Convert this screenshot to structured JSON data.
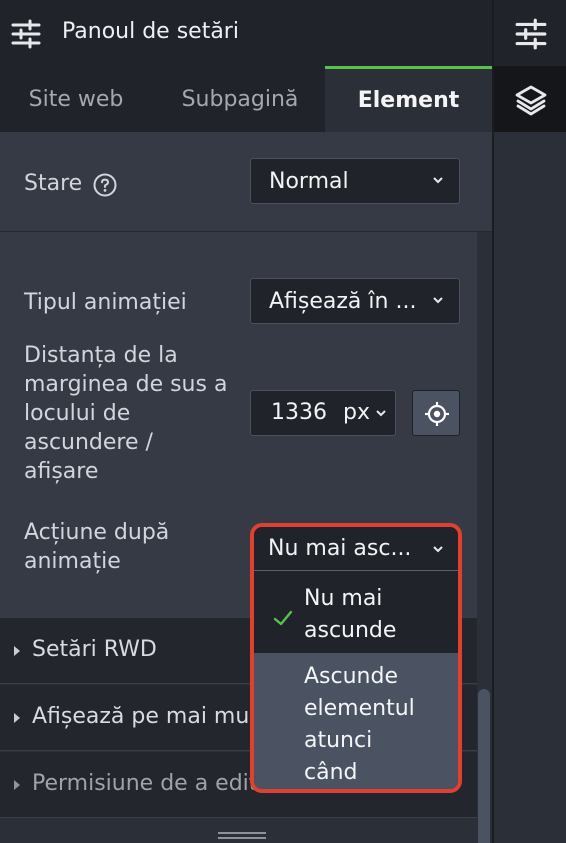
{
  "header": {
    "title": "Panoul de setări",
    "settings_icon": "sliders-icon"
  },
  "rail": {
    "top_icon": "sliders-icon",
    "layers_icon": "layers-icon"
  },
  "tabs": [
    {
      "label": "Site web"
    },
    {
      "label": "Subpagină"
    },
    {
      "label": "Element",
      "active": true
    }
  ],
  "state": {
    "label": "Stare",
    "value": "Normal",
    "help_icon": "help-circle-icon"
  },
  "animation": {
    "type_label": "Tipul animației",
    "type_value": "Afișează în ...",
    "distance_label": [
      "Distanța de la",
      "marginea de sus a",
      "locului de",
      "ascundere /",
      "afișare"
    ],
    "distance_value": "1336",
    "distance_unit": "px",
    "target_icon": "crosshair-icon",
    "after_label": [
      "Acțiune după",
      "animație"
    ],
    "after_value": "Nu mai asc...",
    "options": [
      {
        "label": [
          "Nu mai",
          "ascunde"
        ],
        "selected": true
      },
      {
        "label": [
          "Ascunde",
          "elementul",
          "atunci",
          "când"
        ],
        "selected": false
      }
    ]
  },
  "accordions": [
    {
      "label": "Setări RWD"
    },
    {
      "label": "Afișează pe mai mu"
    },
    {
      "label": "Permisiune de a edit"
    }
  ],
  "colors": {
    "accent": "#56c34a",
    "highlight": "#e0402f",
    "panel": "#353a44",
    "dark": "#20232a"
  }
}
